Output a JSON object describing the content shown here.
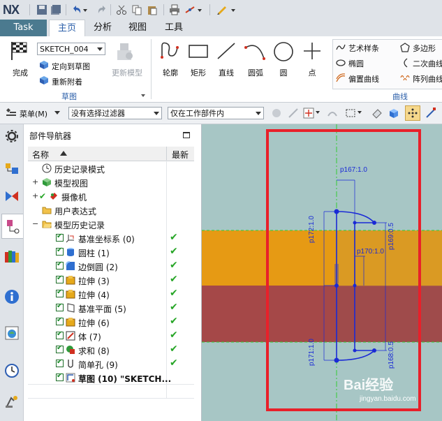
{
  "app": {
    "logo": "NX"
  },
  "tabs": [
    {
      "label": "Task"
    },
    {
      "label": "主页"
    },
    {
      "label": "分析"
    },
    {
      "label": "视图"
    },
    {
      "label": "工具"
    }
  ],
  "ribbon": {
    "finish_label": "完成",
    "sketch_name": "SKETCH_004",
    "orient_label": "定向到草图",
    "reattach_label": "重新附着",
    "update_model_label": "更新模型",
    "sketch_group_label": "草图",
    "tools": [
      {
        "label": "轮廓"
      },
      {
        "label": "矩形"
      },
      {
        "label": "直线"
      },
      {
        "label": "圆弧"
      },
      {
        "label": "圆"
      },
      {
        "label": "点"
      }
    ],
    "curve_items": [
      {
        "label": "艺术样条"
      },
      {
        "label": "多边形"
      },
      {
        "label": "椭圆"
      },
      {
        "label": "二次曲线"
      },
      {
        "label": "偏置曲线"
      },
      {
        "label": "阵列曲线"
      }
    ],
    "curve_group_label": "曲线"
  },
  "filterbar": {
    "menu_label": "菜单(M)",
    "filter_value": "没有选择过滤器",
    "scope_value": "仅在工作部件内"
  },
  "navigator": {
    "title": "部件导航器",
    "col_name": "名称",
    "col_latest": "最新",
    "rows": [
      {
        "label": "历史记录模式"
      },
      {
        "label": "模型视图"
      },
      {
        "label": "摄像机"
      },
      {
        "label": "用户表达式"
      },
      {
        "label": "模型历史记录"
      },
      {
        "label": "基准坐标系 (0)"
      },
      {
        "label": "圆柱 (1)"
      },
      {
        "label": "边倒圆 (2)"
      },
      {
        "label": "拉伸 (3)"
      },
      {
        "label": "拉伸 (4)"
      },
      {
        "label": "基准平面 (5)"
      },
      {
        "label": "拉伸 (6)"
      },
      {
        "label": "体 (7)"
      },
      {
        "label": "求和 (8)"
      },
      {
        "label": "简单孔 (9)"
      },
      {
        "label": "草图 (10) \"SKETCH..."
      }
    ]
  },
  "graphics": {
    "dims": [
      {
        "text": "p167:1.0"
      },
      {
        "text": "p172:1.0"
      },
      {
        "text": "p169:0.5"
      },
      {
        "text": "p170:1.0"
      },
      {
        "text": "p171:1.0"
      },
      {
        "text": "p168:0.5"
      }
    ],
    "watermark": "Bai经验",
    "watermark_url": "jingyan.baidu.com"
  },
  "colors": {
    "accent": "#4b7a8f",
    "viewport_bg": "#a7c6c5",
    "orange_band": "#e69a14",
    "red_band": "#a54848",
    "highlight_frame": "#e8202a",
    "sketch_blue": "#1a2ad6"
  }
}
